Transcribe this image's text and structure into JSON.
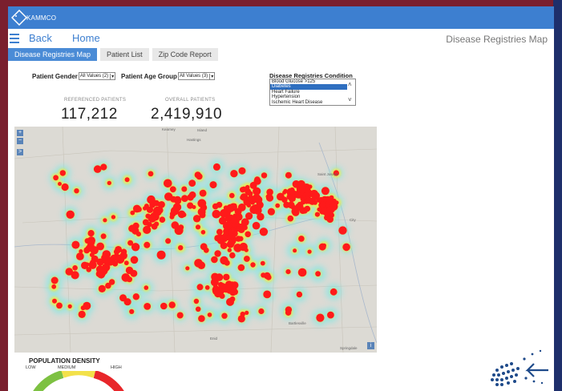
{
  "brand": {
    "logo_text": "KAMMCO"
  },
  "nav": {
    "back": "Back",
    "home": "Home",
    "page_title": "Disease Registries Map"
  },
  "tabs": [
    {
      "label": "Disease Registries Map",
      "active": true
    },
    {
      "label": "Patient List",
      "active": false
    },
    {
      "label": "Zip Code Report",
      "active": false
    }
  ],
  "filters": {
    "gender_label": "Patient Gender",
    "gender_value": "All Values (2)",
    "age_label": "Patient Age Group",
    "age_value": "All Values (3)"
  },
  "conditions": {
    "title": "Disease Registries Condition",
    "items": [
      "Blood Glucose >125",
      "Diabetes",
      "Heart Failure",
      "Hypertension",
      "Ischemic Heart Disease"
    ],
    "selected": "Diabetes"
  },
  "stats": {
    "referenced_label": "REFERENCED PATIENTS",
    "referenced_value": "117,212",
    "overall_label": "OVERALL PATIENTS",
    "overall_value": "2,419,910"
  },
  "map": {
    "zoom_in": "+",
    "zoom_out": "−",
    "expand": ">",
    "info": "i",
    "places": [
      "Kearney",
      "Island",
      "Hastings",
      "Saint Joseph",
      "City",
      "Bartlesville",
      "Enid",
      "Springdale"
    ],
    "heat_colors": {
      "hot": "#ff1a1a",
      "warm": "#f5e84a",
      "cool": "#7ee8e6"
    }
  },
  "density": {
    "title": "POPULATION DENSITY",
    "low": "LOW",
    "medium": "MEDIUM",
    "high": "HIGH"
  },
  "colors": {
    "accent": "#3d7fd0",
    "frame": "#7a1f2e",
    "side_band": "#1e2f6b"
  }
}
